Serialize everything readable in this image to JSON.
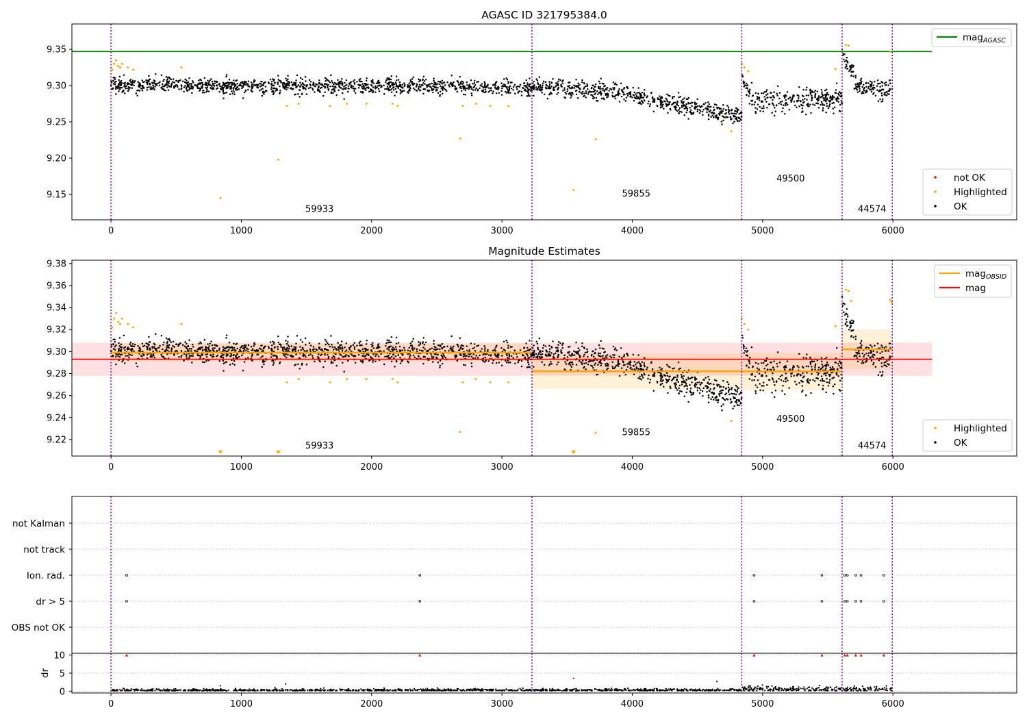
{
  "chart_data": [
    {
      "type": "scatter",
      "title": "AGASC ID 321795384.0",
      "xlim": [
        -300,
        6950
      ],
      "ylim": [
        9.115,
        9.385
      ],
      "xticks": [
        0,
        1000,
        2000,
        3000,
        4000,
        5000,
        6000
      ],
      "yticks": [
        9.15,
        9.2,
        9.25,
        9.3,
        9.35
      ],
      "grid": false,
      "legend_upper": {
        "placement": "top-right",
        "entries": [
          {
            "label": "mag",
            "sub": "AGASC",
            "color": "#008000",
            "kind": "line"
          }
        ]
      },
      "legend_lower": {
        "placement": "bottom-right",
        "entries": [
          {
            "label": "not OK",
            "color": "#ff0000",
            "kind": "dot"
          },
          {
            "label": "Highlighted",
            "color": "#ffa500",
            "kind": "dot"
          },
          {
            "label": "OK",
            "color": "#000000",
            "kind": "dot"
          }
        ]
      },
      "mag_agasc": 9.347,
      "mag_agasc_range": [
        -300,
        6300
      ],
      "obs_boundaries": [
        0,
        3230,
        4840,
        5610,
        5995
      ],
      "obsids": [
        {
          "label": "59933",
          "x": 1600,
          "y": 9.126
        },
        {
          "label": "59855",
          "x": 4030,
          "y": 9.147
        },
        {
          "label": "49500",
          "x": 5215,
          "y": 9.168
        },
        {
          "label": "44574",
          "x": 5840,
          "y": 9.126
        }
      ],
      "trend_segments": [
        {
          "x0": 0,
          "x1": 3230,
          "y0": 9.301,
          "y1": 9.298,
          "spread": 0.009
        },
        {
          "x0": 3230,
          "x1": 3900,
          "y0": 9.3,
          "y1": 9.29,
          "spread": 0.01
        },
        {
          "x0": 3900,
          "x1": 4840,
          "y0": 9.29,
          "y1": 9.258,
          "spread": 0.01
        },
        {
          "x0": 4840,
          "x1": 4900,
          "y0": 9.308,
          "y1": 9.29,
          "spread": 0.008
        },
        {
          "x0": 4900,
          "x1": 5610,
          "y0": 9.28,
          "y1": 9.282,
          "spread": 0.013
        },
        {
          "x0": 5610,
          "x1": 5700,
          "y0": 9.34,
          "y1": 9.32,
          "spread": 0.01
        },
        {
          "x0": 5700,
          "x1": 5995,
          "y0": 9.3,
          "y1": 9.292,
          "spread": 0.01
        }
      ],
      "highlighted": [
        [
          10,
          9.322
        ],
        [
          25,
          9.33
        ],
        [
          40,
          9.335
        ],
        [
          55,
          9.327
        ],
        [
          70,
          9.325
        ],
        [
          85,
          9.33
        ],
        [
          130,
          9.325
        ],
        [
          170,
          9.322
        ],
        [
          540,
          9.325
        ],
        [
          840,
          9.145
        ],
        [
          1285,
          9.198
        ],
        [
          1350,
          9.272
        ],
        [
          1440,
          9.275
        ],
        [
          1680,
          9.272
        ],
        [
          1810,
          9.275
        ],
        [
          1960,
          9.275
        ],
        [
          2160,
          9.275
        ],
        [
          2200,
          9.272
        ],
        [
          2680,
          9.227
        ],
        [
          2700,
          9.272
        ],
        [
          2800,
          9.275
        ],
        [
          2910,
          9.272
        ],
        [
          3050,
          9.272
        ],
        [
          3550,
          9.156
        ],
        [
          3720,
          9.226
        ],
        [
          4760,
          9.237
        ],
        [
          4840,
          9.33
        ],
        [
          4860,
          9.325
        ],
        [
          4890,
          9.32
        ],
        [
          5560,
          9.323
        ],
        [
          5640,
          9.356
        ],
        [
          5660,
          9.355
        ],
        [
          5980,
          9.347
        ]
      ]
    },
    {
      "type": "scatter",
      "title": "Magnitude Estimates",
      "xlim": [
        -300,
        6950
      ],
      "ylim": [
        9.205,
        9.383
      ],
      "xticks": [
        0,
        1000,
        2000,
        3000,
        4000,
        5000,
        6000
      ],
      "yticks": [
        9.22,
        9.24,
        9.26,
        9.28,
        9.3,
        9.32,
        9.34,
        9.36,
        9.38
      ],
      "grid": false,
      "legend_upper": {
        "placement": "top-right",
        "entries": [
          {
            "label": "mag",
            "sub": "OBSID",
            "color": "#ffa500",
            "kind": "line"
          },
          {
            "label": "mag",
            "sub": "",
            "color": "#ff0000",
            "kind": "line"
          }
        ]
      },
      "legend_lower": {
        "placement": "bottom-right",
        "entries": [
          {
            "label": "Highlighted",
            "color": "#ffa500",
            "kind": "dot"
          },
          {
            "label": "OK",
            "color": "#000000",
            "kind": "dot"
          }
        ]
      },
      "mag": 9.293,
      "mag_band": [
        9.278,
        9.308
      ],
      "mag_range": [
        -300,
        6300
      ],
      "mag_obsid": [
        {
          "x0": 0,
          "x1": 3230,
          "y": 9.299,
          "band": [
            9.291,
            9.307
          ]
        },
        {
          "x0": 3230,
          "x1": 4840,
          "y": 9.282,
          "band": [
            9.266,
            9.298
          ]
        },
        {
          "x0": 4840,
          "x1": 5610,
          "y": 9.282,
          "band": [
            9.265,
            9.299
          ]
        },
        {
          "x0": 5610,
          "x1": 5995,
          "y": 9.302,
          "band": [
            9.284,
            9.32
          ]
        }
      ],
      "obs_boundaries": [
        0,
        3230,
        4840,
        5610,
        5995
      ],
      "obsids": [
        {
          "label": "59933",
          "x": 1600,
          "y": 9.212
        },
        {
          "label": "59855",
          "x": 4030,
          "y": 9.224
        },
        {
          "label": "49500",
          "x": 5215,
          "y": 9.236
        },
        {
          "label": "44574",
          "x": 5840,
          "y": 9.212
        }
      ],
      "offscale_markers": [
        840,
        1285,
        3550
      ],
      "highlighted": [
        [
          10,
          9.322
        ],
        [
          25,
          9.33
        ],
        [
          40,
          9.335
        ],
        [
          55,
          9.327
        ],
        [
          70,
          9.325
        ],
        [
          85,
          9.33
        ],
        [
          130,
          9.325
        ],
        [
          170,
          9.322
        ],
        [
          540,
          9.325
        ],
        [
          1350,
          9.272
        ],
        [
          1440,
          9.275
        ],
        [
          1680,
          9.272
        ],
        [
          1810,
          9.275
        ],
        [
          1960,
          9.275
        ],
        [
          2160,
          9.275
        ],
        [
          2200,
          9.272
        ],
        [
          2680,
          9.227
        ],
        [
          2700,
          9.272
        ],
        [
          2800,
          9.275
        ],
        [
          2910,
          9.272
        ],
        [
          3050,
          9.272
        ],
        [
          3720,
          9.226
        ],
        [
          4760,
          9.237
        ],
        [
          4840,
          9.33
        ],
        [
          4860,
          9.325
        ],
        [
          4890,
          9.32
        ],
        [
          5560,
          9.323
        ],
        [
          5640,
          9.356
        ],
        [
          5660,
          9.355
        ],
        [
          5680,
          9.346
        ],
        [
          5980,
          9.347
        ],
        [
          5990,
          9.345
        ]
      ]
    },
    {
      "type": "scatter",
      "title": "",
      "xlim": [
        -300,
        6950
      ],
      "categories": [
        "not Kalman",
        "not track",
        "Ion. rad.",
        "dr > 5",
        "OBS not OK"
      ],
      "grid": true,
      "obs_boundaries": [
        0,
        3230,
        4840,
        5610,
        5995
      ],
      "flag_events": {
        "Ion. rad.": [
          120,
          2370,
          4935,
          5455,
          5630,
          5650,
          5715,
          5755,
          5930
        ],
        "dr > 5": [
          120,
          2370,
          4935,
          5455,
          5630,
          5650,
          5715,
          5755,
          5930
        ]
      }
    },
    {
      "type": "scatter",
      "title": "",
      "ylabel": "dr",
      "xlim": [
        -300,
        6950
      ],
      "ylim": [
        -0.5,
        10.5
      ],
      "xticks": [
        0,
        1000,
        2000,
        3000,
        4000,
        5000,
        6000
      ],
      "yticks": [
        0,
        5,
        10
      ],
      "grid": true,
      "obs_boundaries": [
        0,
        3230,
        4840,
        5610,
        5995
      ],
      "clipped_points": [
        120,
        2370,
        4935,
        5455,
        5630,
        5650,
        5715,
        5755,
        5930
      ],
      "dr_outliers": [
        [
          3550,
          3.5
        ],
        [
          4650,
          2.7
        ],
        [
          1340,
          2.0
        ],
        [
          840,
          1.5
        ]
      ]
    }
  ]
}
